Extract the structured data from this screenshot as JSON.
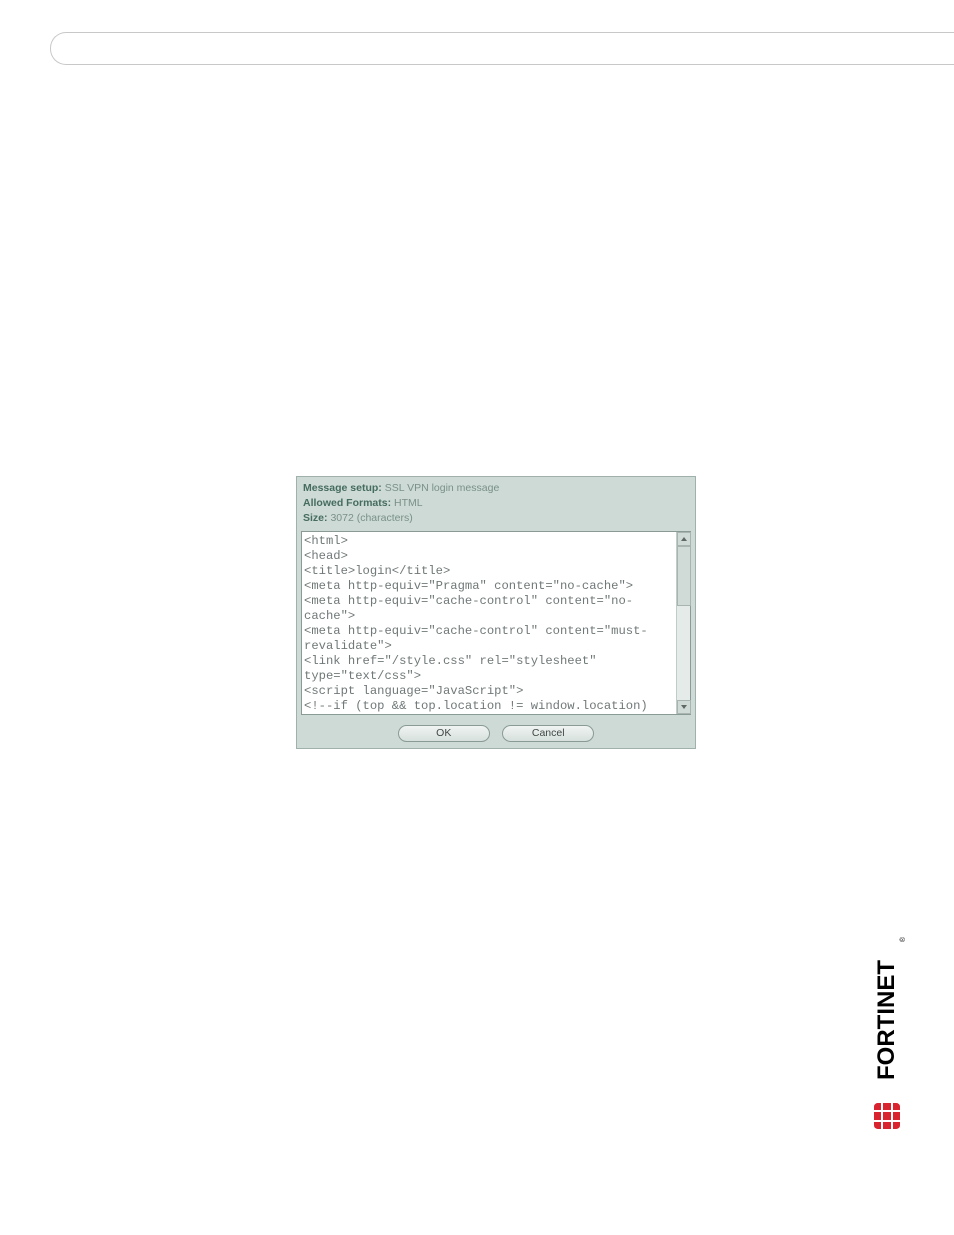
{
  "dialog": {
    "header": {
      "msg_label": "Message setup:",
      "msg_value": "SSL VPN login message",
      "fmt_label": "Allowed Formats:",
      "fmt_value": "HTML",
      "size_label": "Size:",
      "size_value": "3072 (characters)"
    },
    "textarea": "<html>\n<head>\n<title>login</title>\n<meta http-equiv=\"Pragma\" content=\"no-cache\">\n<meta http-equiv=\"cache-control\" content=\"no-cache\">\n<meta http-equiv=\"cache-control\" content=\"must-revalidate\">\n<link href=\"/style.css\" rel=\"stylesheet\" type=\"text/css\">\n<script language=\"JavaScript\">\n<!--if (top && top.location != window.location)",
    "buttons": {
      "ok": "OK",
      "cancel": "Cancel"
    }
  },
  "logo": {
    "text": "FORTINET",
    "reg": "®"
  }
}
